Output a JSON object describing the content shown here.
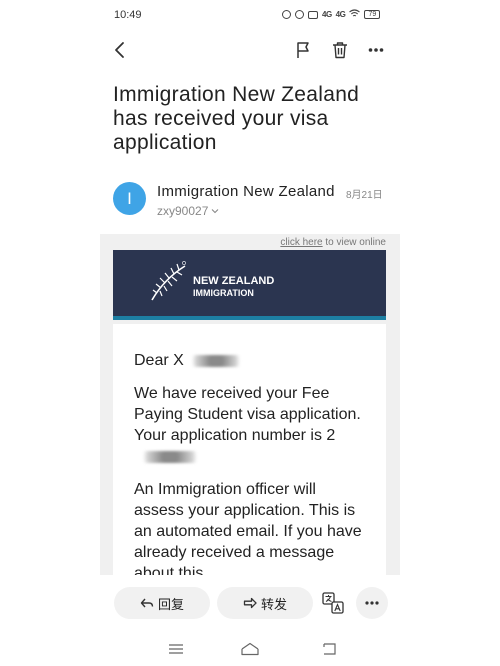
{
  "status_bar": {
    "time": "10:49",
    "signal_1": "4G",
    "signal_2": "4G",
    "battery": "79"
  },
  "top_nav": {
    "back_icon": "chevron-left-icon",
    "flag_icon": "flag-icon",
    "trash_icon": "trash-icon",
    "more_icon": "more-horizontal-icon"
  },
  "email": {
    "subject": "Immigration New Zealand has received your visa application",
    "sender": {
      "avatar_letter": "I",
      "avatar_color": "#3fa4e6",
      "name": "Immigration New Zealand",
      "date": "8月21日",
      "recipient": "zxy90027"
    },
    "body": {
      "view_online_link": "click here",
      "view_online_rest": " to view online",
      "brand_line1": "NEW ZEALAND",
      "brand_line2": "IMMIGRATION",
      "greeting": "Dear X",
      "para1_start": "We have received your Fee Paying Student visa application. Your application number is 2",
      "para2": "An Immigration officer will assess your application. This is an automated email. If you have already received a message about this"
    }
  },
  "actions": {
    "reply_label": "回复",
    "forward_label": "转发",
    "translate_icon": "translate-icon",
    "more_icon": "more-horizontal-icon"
  },
  "colors": {
    "banner": "#2b3550",
    "banner_stripe": "#1d7fa3",
    "accent": "#3fa4e6"
  }
}
